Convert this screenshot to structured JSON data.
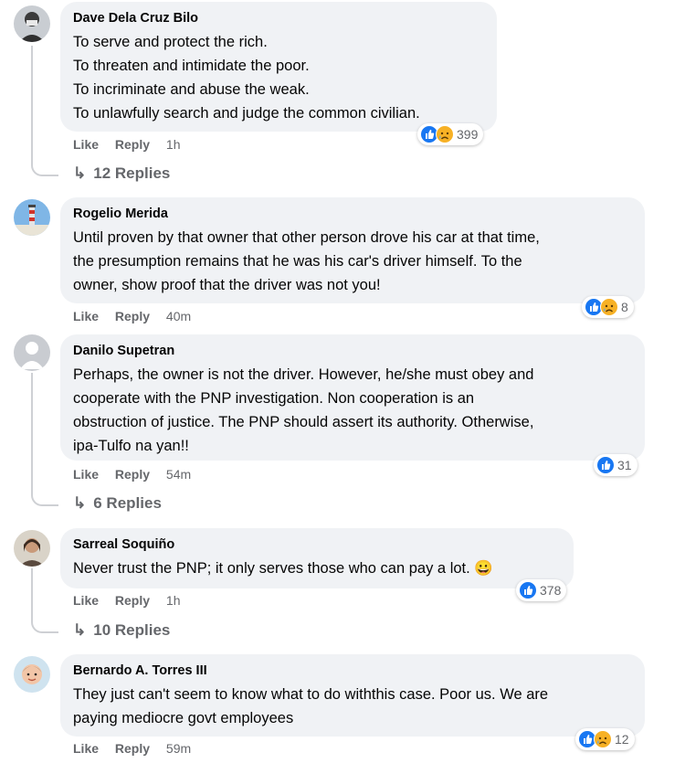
{
  "comments": [
    {
      "author": "Dave Dela Cruz Bilo",
      "lines": [
        "To serve and protect the rich.",
        "To threaten and intimidate the poor.",
        "To incriminate and abuse the weak.",
        "To unlawfully search and judge the common civilian."
      ],
      "like_label": "Like",
      "reply_label": "Reply",
      "time": "1h",
      "reaction_count": "399",
      "reactions": [
        "like-icon",
        "sad-icon"
      ],
      "replies_label": "12 Replies"
    },
    {
      "author": "Rogelio Merida",
      "lines": [
        "Until proven by that owner that other person drove his car at that time,",
        "the presumption remains that he was his car's driver himself. To the",
        "owner, show proof that the driver was not you!"
      ],
      "like_label": "Like",
      "reply_label": "Reply",
      "time": "40m",
      "reaction_count": "8",
      "reactions": [
        "like-icon",
        "sad-icon"
      ]
    },
    {
      "author": "Danilo Supetran",
      "lines": [
        "Perhaps, the owner is not the driver. However, he/she must obey and",
        "cooperate with the PNP investigation. Non cooperation is an",
        "obstruction of justice. The PNP should assert its authority. Otherwise,",
        "ipa-Tulfo na yan!!"
      ],
      "like_label": "Like",
      "reply_label": "Reply",
      "time": "54m",
      "reaction_count": "31",
      "reactions": [
        "like-icon"
      ],
      "replies_label": "6 Replies"
    },
    {
      "author": "Sarreal Soquiño",
      "lines": [
        "Never trust the PNP; it only serves those who can pay a lot. 😀"
      ],
      "like_label": "Like",
      "reply_label": "Reply",
      "time": "1h",
      "reaction_count": "378",
      "reactions": [
        "like-icon"
      ],
      "replies_label": "10 Replies"
    },
    {
      "author": "Bernardo A. Torres III",
      "lines": [
        "They just can't seem to know what to do withthis case. Poor us. We are",
        "paying mediocre govt employees"
      ],
      "like_label": "Like",
      "reply_label": "Reply",
      "time": "59m",
      "reaction_count": "12",
      "reactions": [
        "like-icon",
        "sad-icon"
      ]
    }
  ],
  "colors": {
    "bubble": "#f0f2f5",
    "like_blue": "#1877f2",
    "sad_yellow": "#f7b125",
    "meta_gray": "#65676b"
  }
}
